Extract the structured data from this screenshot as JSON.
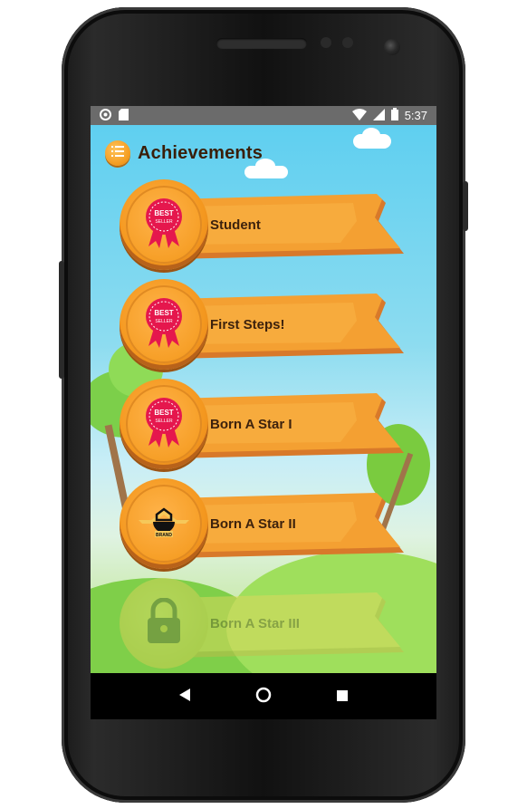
{
  "status_bar": {
    "time": "5:37",
    "icons": [
      "circle-notification-icon",
      "sd-card-icon",
      "wifi-icon",
      "signal-icon",
      "battery-icon"
    ]
  },
  "header": {
    "title": "Achievements",
    "menu_icon": "menu-icon"
  },
  "achievements": [
    {
      "label": "Student",
      "badge": "best-seller-badge-icon",
      "badge_text_top": "BEST",
      "badge_text_bottom": "SELLER",
      "locked": false
    },
    {
      "label": "First Steps!",
      "badge": "best-seller-badge-icon",
      "badge_text_top": "BEST",
      "badge_text_bottom": "SELLER",
      "locked": false
    },
    {
      "label": "Born A Star I",
      "badge": "best-seller-badge-icon",
      "badge_text_top": "BEST",
      "badge_text_bottom": "SELLER",
      "locked": false
    },
    {
      "label": "Born A Star II",
      "badge": "emblem-badge-icon",
      "badge_text_top": "",
      "badge_text_bottom": "BRAND",
      "locked": false
    },
    {
      "label": "Born A Star III",
      "badge": "lock-icon",
      "locked": true
    }
  ],
  "nav_bar": {
    "back": "back-icon",
    "home": "home-icon",
    "recents": "recents-icon"
  },
  "colors": {
    "wood": "#f4981f",
    "title_text": "#3a1e08",
    "badge_red": "#e5174d",
    "sky": "#5fcff0"
  }
}
